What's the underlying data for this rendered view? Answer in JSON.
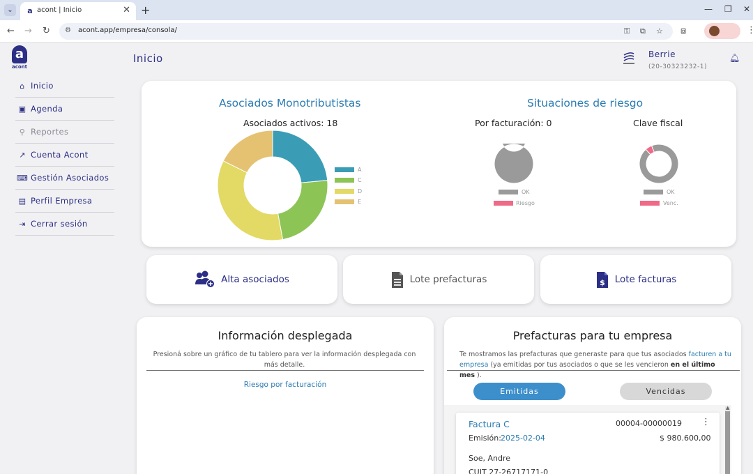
{
  "browser": {
    "tab_title": "acont | Inicio",
    "url": "acont.app/empresa/consola/"
  },
  "header": {
    "logo_text": "acont",
    "page_title": "Inicio",
    "company_name": "Berrie",
    "company_cuit": "(20-30323232-1)"
  },
  "sidebar": {
    "items": [
      {
        "label": "Inicio",
        "icon": "home-icon"
      },
      {
        "label": "Agenda",
        "icon": "contact-book-icon"
      },
      {
        "label": "Reportes",
        "icon": "magnifier-chart-icon"
      },
      {
        "label": "Cuenta Acont",
        "icon": "line-chart-icon"
      },
      {
        "label": "Gestión Asociados",
        "icon": "keyboard-card-icon"
      },
      {
        "label": "Perfil Empresa",
        "icon": "id-card-icon"
      },
      {
        "label": "Cerrar sesión",
        "icon": "logout-icon"
      }
    ]
  },
  "overview": {
    "left_title": "Asociados Monotributistas",
    "active_label": "Asociados activos: 18",
    "right_title": "Situaciones de riesgo",
    "billing_label": "Por facturación: 0",
    "fiscal_label": "Clave fiscal",
    "billing_legend": [
      "OK",
      "Riesgo"
    ],
    "fiscal_legend": [
      "OK",
      "Venc."
    ]
  },
  "chart_data": [
    {
      "type": "pie",
      "title": "Asociados activos: 18",
      "categories": [
        "A",
        "C",
        "D",
        "E"
      ],
      "values": [
        4,
        4,
        6,
        3
      ],
      "colors": [
        "#3a9db5",
        "#8dc456",
        "#e3d965",
        "#e5c272"
      ]
    },
    {
      "type": "pie",
      "title": "Por facturación: 0",
      "categories": [
        "OK",
        "Riesgo"
      ],
      "values": [
        18,
        0
      ],
      "colors": [
        "#9a9a9a",
        "#f06987"
      ]
    },
    {
      "type": "pie",
      "title": "Clave fiscal",
      "categories": [
        "OK",
        "Venc."
      ],
      "values": [
        17,
        1
      ],
      "colors": [
        "#9a9a9a",
        "#f06987"
      ]
    }
  ],
  "actions": {
    "alta": "Alta asociados",
    "lote_pref": "Lote prefacturas",
    "lote_fact": "Lote facturas"
  },
  "info": {
    "title": "Información desplegada",
    "description": "Presioná sobre un gráfico de tu tablero para ver la información desplegada con más detalle.",
    "link": "Riesgo por facturación"
  },
  "prefacturas": {
    "title": "Prefacturas para tu empresa",
    "desc_start": "Te mostramos las prefacturas que generaste para que tus asociados ",
    "desc_link": "facturen a tu empresa",
    "desc_mid": " (ya emitidas por tus asociados o que se les vencieron ",
    "desc_bold": "en el último mes",
    "desc_end": " ).",
    "tab_emitidas": "Emitidas",
    "tab_vencidas": "Vencidas",
    "invoice": {
      "type": "Factura C",
      "number": "00004-00000019",
      "emission_label": "Emisión:",
      "emission_date": "2025-02-04",
      "amount": "$ 980.600,00",
      "name": "Soe, Andre",
      "cuit": "CUIT 27-26717171-0"
    }
  }
}
